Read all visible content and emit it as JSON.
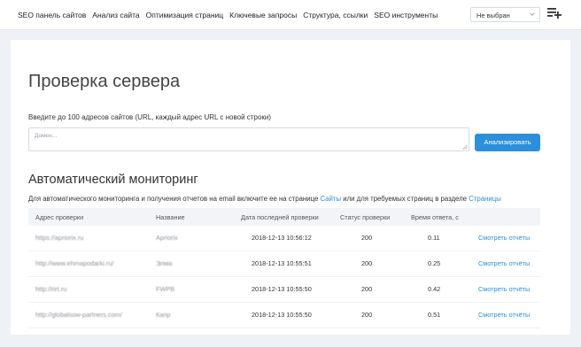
{
  "nav": {
    "items": [
      {
        "label": "SEO панель сайтов"
      },
      {
        "label": "Анализ сайта"
      },
      {
        "label": "Оптимизация страниц"
      },
      {
        "label": "Ключевые запросы"
      },
      {
        "label": "Структура, ссылки"
      },
      {
        "label": "SEO инструменты"
      }
    ],
    "site_select": "Не выбран",
    "add_icon": "playlist-add-icon"
  },
  "page": {
    "title": "Проверка сервера",
    "hint": "Введите до 100 адресов сайтов (URL, каждый адрес URL с новой строки)",
    "textarea_placeholder": "Домен...",
    "analyze_button": "Анализировать"
  },
  "monitoring": {
    "title": "Автоматический мониторинг",
    "desc_before": "Для автоматического мониторинга и получения отчетов на email включите ее на странице ",
    "desc_link1": "Сайты",
    "desc_middle": " или для требуемых страниц в разделе ",
    "desc_link2": "Страницы"
  },
  "table": {
    "headers": [
      "Адрес проверки",
      "Название",
      "Дата последней проверки",
      "Статус проверки",
      "Время ответа, с"
    ],
    "rows": [
      {
        "url": "https://apriorix.ru",
        "name": "Apriorix",
        "date": "2018-12-13 10:56:12",
        "status": "200",
        "time": "0.11",
        "action": "Смотреть отчёты"
      },
      {
        "url": "http://www.ehmapodarki.ru/",
        "name": "Элма",
        "date": "2018-12-13 10:55:51",
        "status": "200",
        "time": "0.25",
        "action": "Смотреть отчёты"
      },
      {
        "url": "http://rirt.ru",
        "name": "FWPB",
        "date": "2018-12-13 10:55:50",
        "status": "200",
        "time": "0.42",
        "action": "Смотреть отчёты"
      },
      {
        "url": "http://globalsow-partners.com/",
        "name": "Капр",
        "date": "2018-12-13 10:55:50",
        "status": "200",
        "time": "0.51",
        "action": "Смотреть отчёты"
      }
    ]
  },
  "colors": {
    "accent": "#2b8fdc",
    "background": "#eef1f5"
  }
}
